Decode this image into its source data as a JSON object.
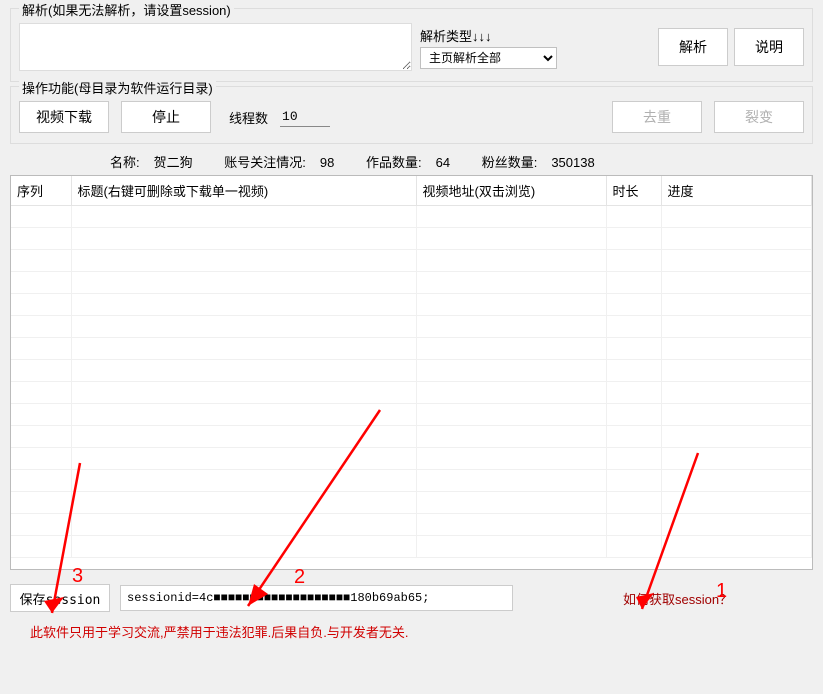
{
  "parse_group": {
    "title": "解析(如果无法解析，请设置session)",
    "type_label": "解析类型↓↓↓",
    "type_selected": "主页解析全部",
    "parse_btn": "解析",
    "help_btn": "说明"
  },
  "ops_group": {
    "title": "操作功能(母目录为软件运行目录)",
    "download_btn": "视频下载",
    "stop_btn": "停止",
    "thread_label": "线程数",
    "thread_value": "10",
    "dedupe_btn": "去重",
    "fission_btn": "裂变"
  },
  "info": {
    "name_label": "名称:",
    "name_value": "贺二狗",
    "follow_label": "账号关注情况:",
    "follow_value": "98",
    "works_label": "作品数量:",
    "works_value": "64",
    "fans_label": "粉丝数量:",
    "fans_value": "350138"
  },
  "table": {
    "headers": {
      "seq": "序列",
      "title": "标题(右键可删除或下载单一视频)",
      "url": "视频地址(双击浏览)",
      "duration": "时长",
      "progress": "进度"
    }
  },
  "session": {
    "save_btn": "保存session",
    "value": "sessionid=4c■■■■■■■■■■■■■■■■■■■180b69ab65;",
    "howto_link": "如何获取session？"
  },
  "disclaimer": "此软件只用于学习交流,严禁用于违法犯罪.后果自负.与开发者无关.",
  "annotations": {
    "n1": "1",
    "n2": "2",
    "n3": "3"
  }
}
